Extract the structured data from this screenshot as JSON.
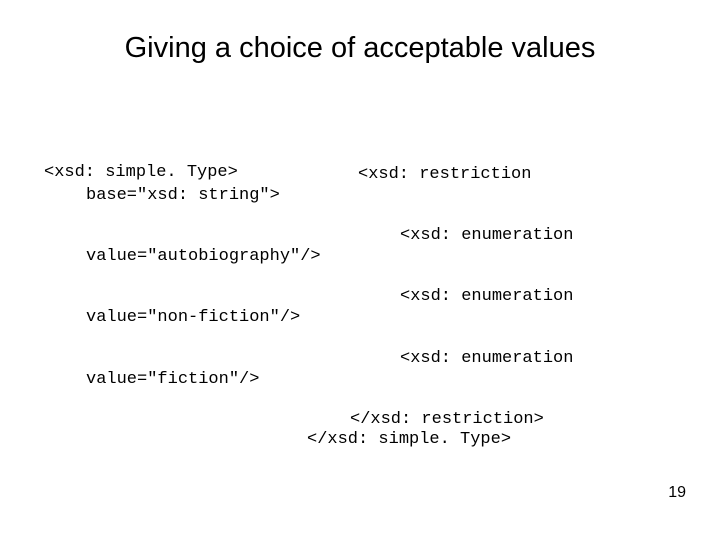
{
  "title": "Giving a choice of acceptable values",
  "code": {
    "l1": "<xsd: simple. Type>",
    "r1": "<xsd: restriction",
    "l2": "base=\"xsd: string\">",
    "r2": "<xsd: enumeration",
    "l3": "value=\"autobiography\"/>",
    "r3": "<xsd: enumeration",
    "l4": "value=\"non-fiction\"/>",
    "r4": "<xsd: enumeration",
    "l5": "value=\"fiction\"/>",
    "close1": "</xsd: restriction>",
    "close2": "</xsd: simple. Type>"
  },
  "page_number": "19"
}
